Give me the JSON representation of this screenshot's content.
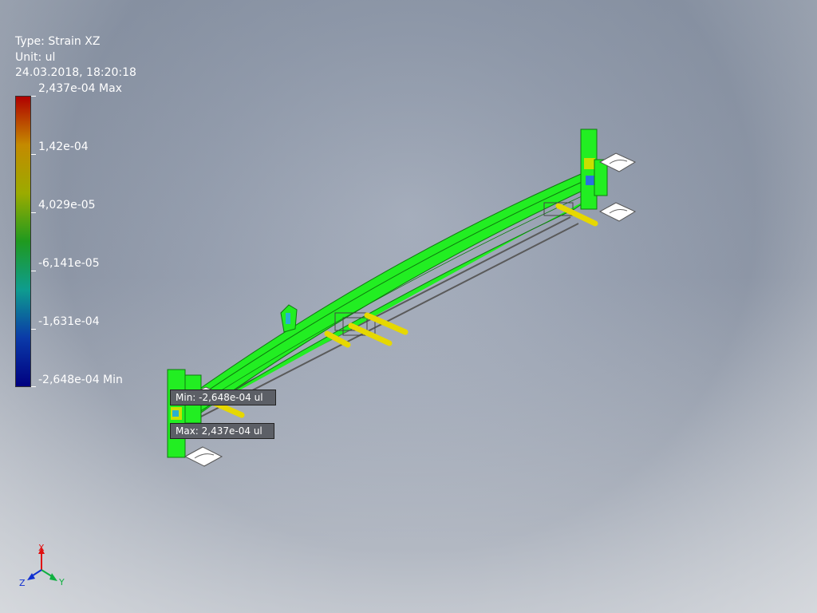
{
  "legend": {
    "type_label": "Type: Strain XZ",
    "unit_label": "Unit: ul",
    "timestamp": "24.03.2018, 18:20:18",
    "ticks": [
      {
        "label": "2,437e-04 Max"
      },
      {
        "label": "1,42e-04"
      },
      {
        "label": "4,029e-05"
      },
      {
        "label": "-6,141e-05"
      },
      {
        "label": "-1,631e-04"
      },
      {
        "label": "-2,648e-04 Min"
      }
    ],
    "colors": [
      "#b00000",
      "#c48a00",
      "#9bab00",
      "#1f9a1f",
      "#0e9c8f",
      "#0a3aa8",
      "#000080"
    ]
  },
  "probes": {
    "min_label": "Min: -2,648e-04 ul",
    "max_label": "Max: 2,437e-04 ul"
  },
  "triad": {
    "x": "X",
    "y": "Y",
    "z": "Z",
    "x_color": "#e01010",
    "y_color": "#10b040",
    "z_color": "#1030d0"
  },
  "model_colors": {
    "frame": "#22ee22",
    "pins": "#e6d800",
    "constraints": "#ffffff"
  }
}
